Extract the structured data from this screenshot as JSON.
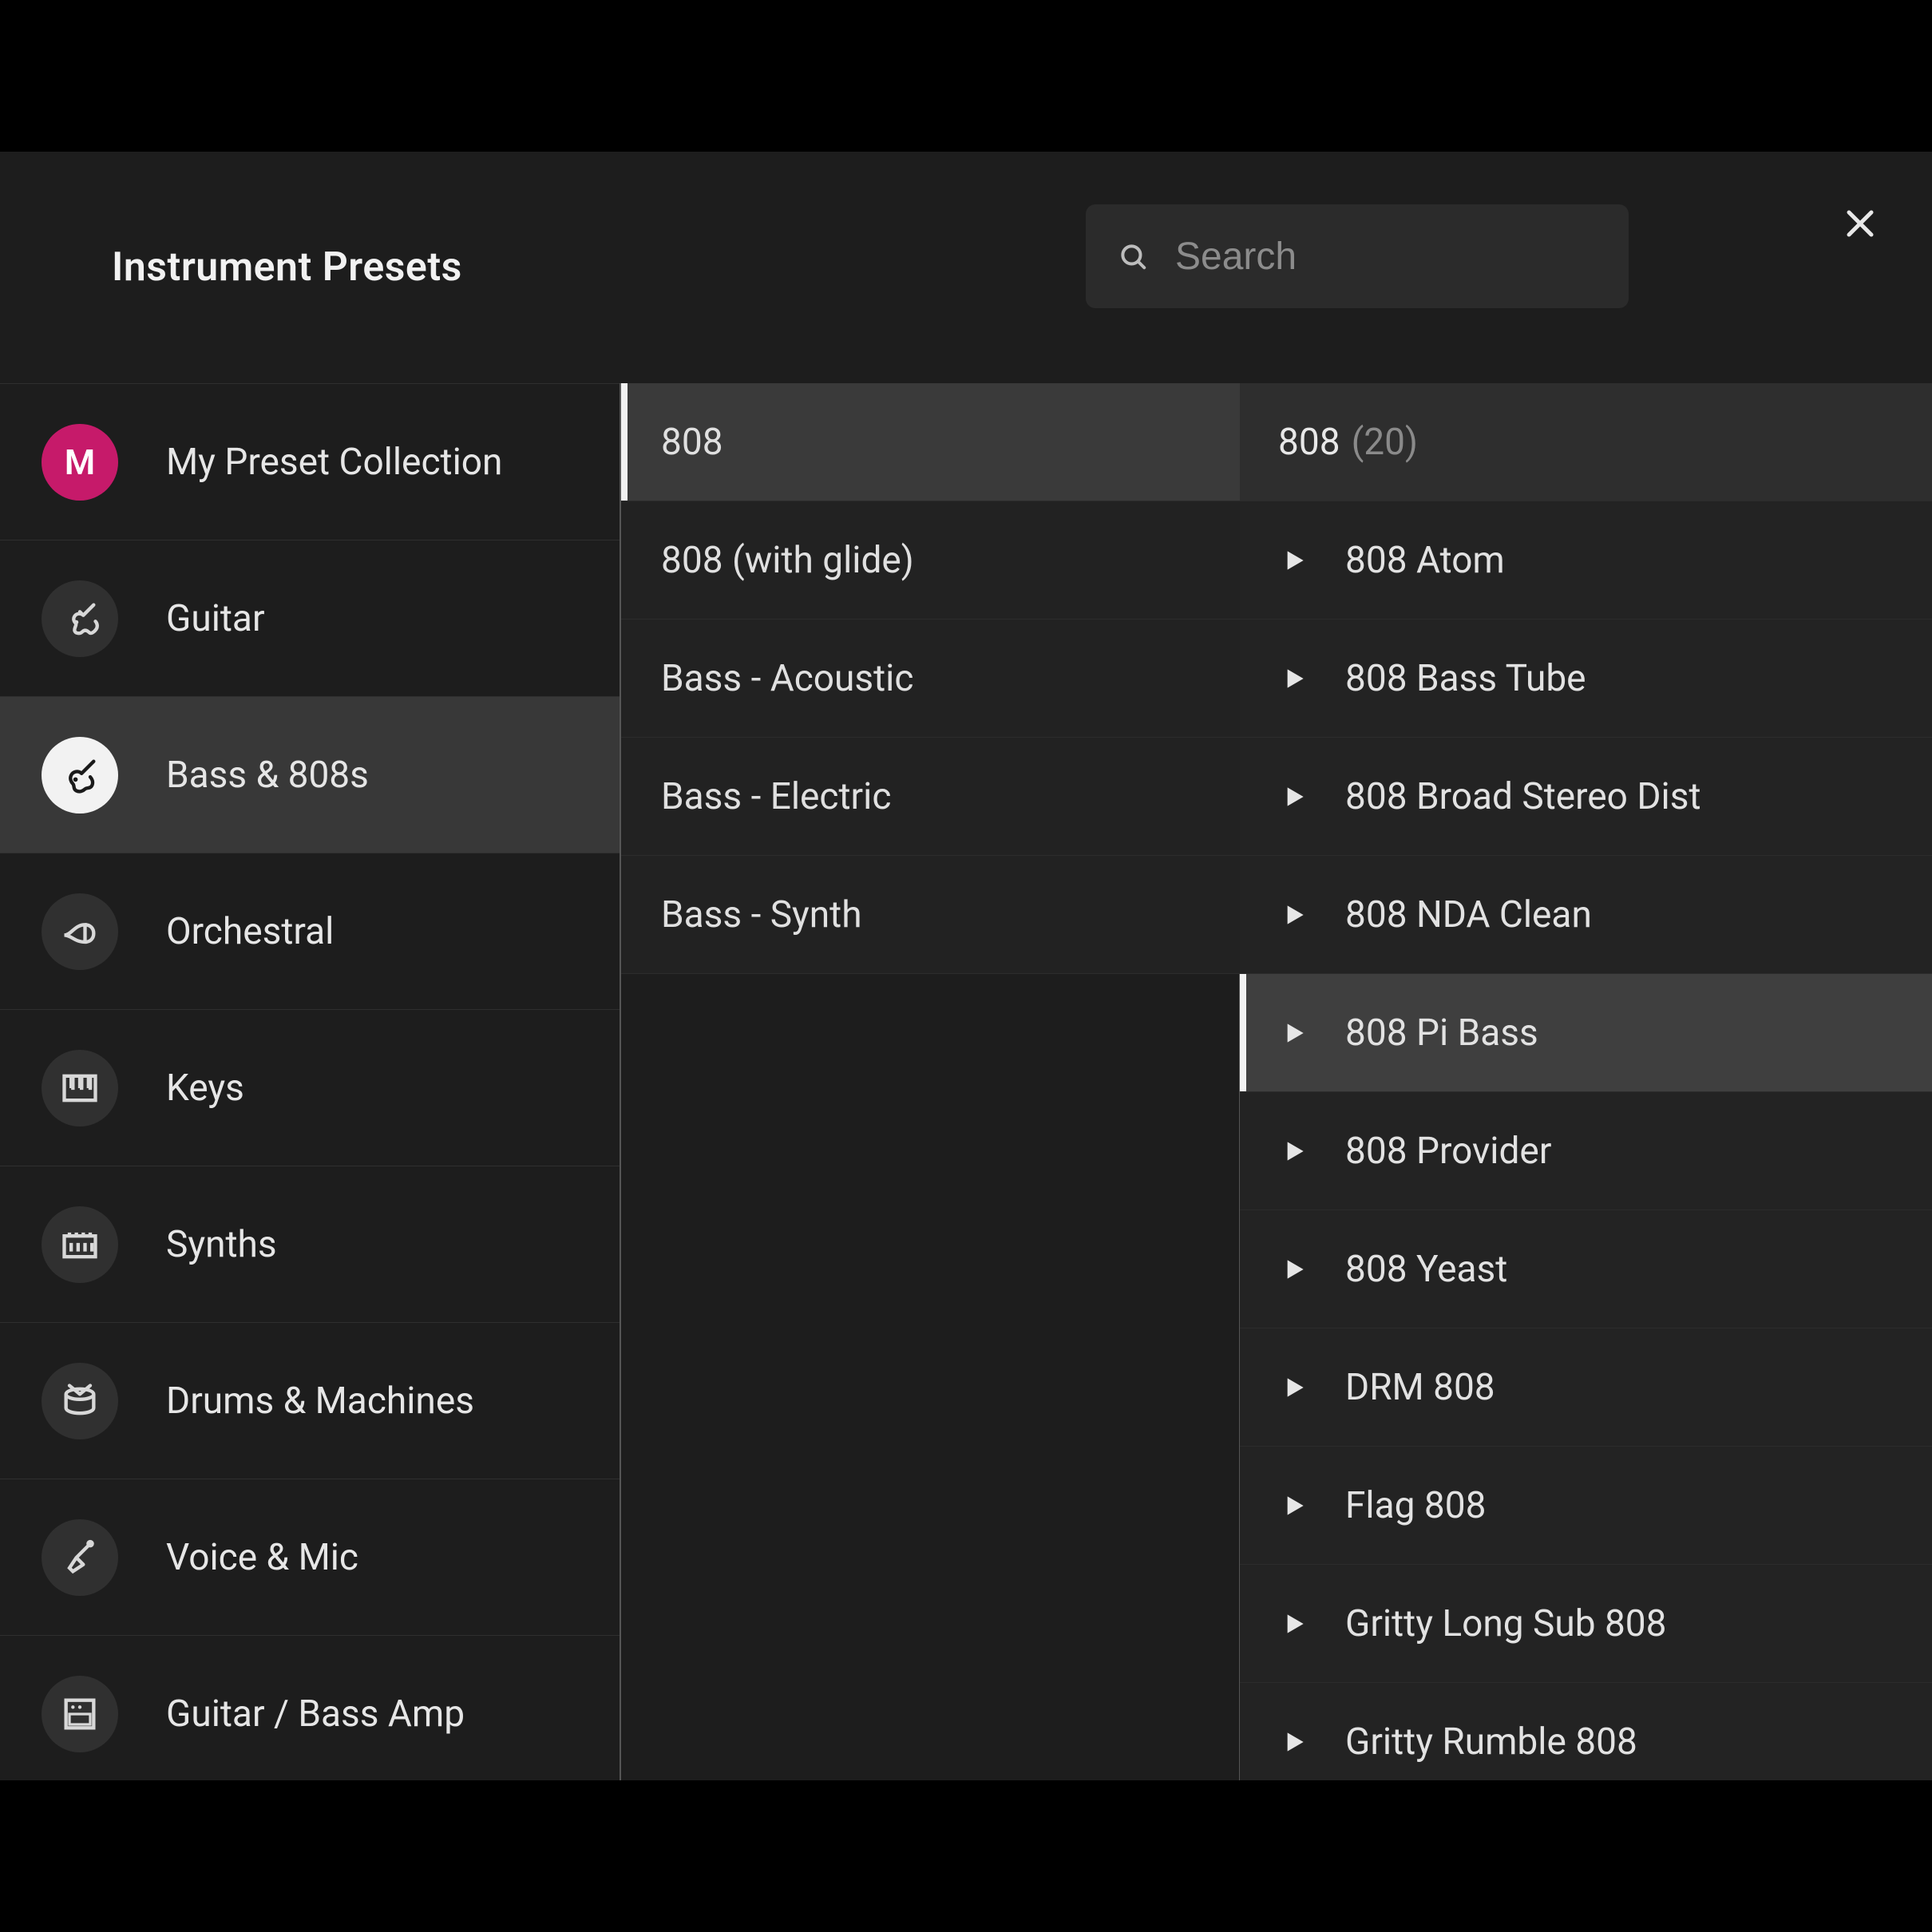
{
  "header": {
    "title": "Instrument Presets",
    "search_placeholder": "Search"
  },
  "categories": {
    "my_collection_badge": "M",
    "items": [
      {
        "label": "My Preset Collection",
        "icon": "badge"
      },
      {
        "label": "Guitar",
        "icon": "guitar"
      },
      {
        "label": "Bass & 808s",
        "icon": "bass",
        "selected": true
      },
      {
        "label": "Orchestral",
        "icon": "horn"
      },
      {
        "label": "Keys",
        "icon": "piano"
      },
      {
        "label": "Synths",
        "icon": "synth"
      },
      {
        "label": "Drums & Machines",
        "icon": "drum"
      },
      {
        "label": "Voice & Mic",
        "icon": "mic"
      },
      {
        "label": "Guitar / Bass Amp",
        "icon": "amp"
      }
    ]
  },
  "subcategories": [
    {
      "label": "808",
      "selected": true
    },
    {
      "label": "808 (with glide)"
    },
    {
      "label": "Bass - Acoustic"
    },
    {
      "label": "Bass - Electric"
    },
    {
      "label": "Bass - Synth"
    }
  ],
  "presets": {
    "header_label": "808",
    "header_count": "(20)",
    "items": [
      {
        "label": "808 Atom"
      },
      {
        "label": "808 Bass Tube"
      },
      {
        "label": "808 Broad Stereo Dist"
      },
      {
        "label": "808 NDA Clean"
      },
      {
        "label": "808 Pi Bass",
        "selected": true
      },
      {
        "label": "808 Provider"
      },
      {
        "label": "808 Yeast"
      },
      {
        "label": "DRM 808"
      },
      {
        "label": "Flag 808"
      },
      {
        "label": "Gritty Long Sub 808"
      },
      {
        "label": "Gritty Rumble 808"
      }
    ]
  }
}
